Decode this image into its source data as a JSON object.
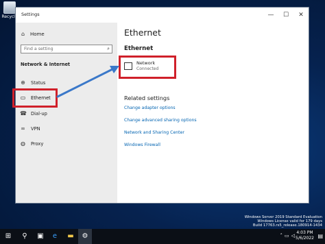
{
  "desktop": {
    "recycle_label": "Recycle"
  },
  "window": {
    "title": "Settings",
    "controls": {
      "minimize": "—",
      "maximize": "☐",
      "close": "✕"
    }
  },
  "sidebar": {
    "home_label": "Home",
    "search_placeholder": "Find a setting",
    "section_title": "Network & Internet",
    "items": [
      {
        "label": "Status",
        "icon": "status-icon"
      },
      {
        "label": "Ethernet",
        "icon": "ethernet-icon"
      },
      {
        "label": "Dial-up",
        "icon": "dialup-icon"
      },
      {
        "label": "VPN",
        "icon": "vpn-icon"
      },
      {
        "label": "Proxy",
        "icon": "proxy-icon"
      }
    ]
  },
  "content": {
    "page_title": "Ethernet",
    "section_title": "Ethernet",
    "network": {
      "name": "Network",
      "status": "Connected"
    },
    "related_title": "Related settings",
    "links": [
      "Change adapter options",
      "Change advanced sharing options",
      "Network and Sharing Center",
      "Windows Firewall"
    ]
  },
  "taskbar": {
    "time": "4:03 PM",
    "date": "5/6/2022"
  },
  "watermark": {
    "line1": "Windows Server 2019 Standard Evaluation",
    "line2": "Windows License valid for 179 days",
    "line3": "Build 17763.rs5_release.180914-1434"
  },
  "colors": {
    "highlight": "#d0202a",
    "arrow": "#3a78c9",
    "link": "#0063b1"
  }
}
